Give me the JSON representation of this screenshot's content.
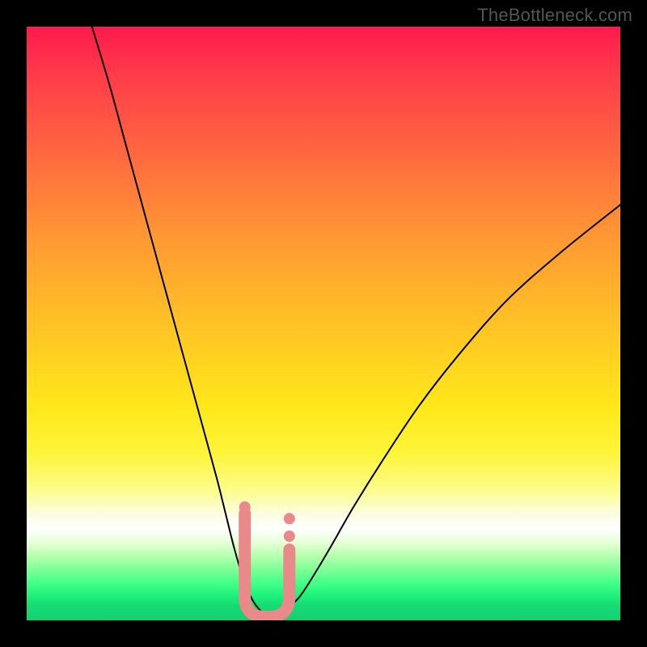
{
  "watermark": "TheBottleneck.com",
  "chart_data": {
    "type": "line",
    "title": "",
    "xlabel": "",
    "ylabel": "",
    "xlim": [
      0,
      100
    ],
    "ylim": [
      0,
      100
    ],
    "grid": false,
    "series": [
      {
        "name": "bottleneck-curve",
        "x": [
          11,
          14,
          17,
          20,
          23,
          26,
          29,
          32,
          33.5,
          35,
          36.5,
          38,
          39.5,
          41,
          42.5,
          44,
          46,
          48,
          51,
          55,
          60,
          66,
          73,
          81,
          90,
          100
        ],
        "y": [
          100,
          90,
          79,
          68,
          57,
          46,
          35,
          24,
          18,
          12,
          7,
          3.5,
          1.5,
          0.5,
          0.8,
          2,
          4,
          7,
          12,
          19,
          27,
          36,
          45,
          54,
          62,
          70
        ]
      }
    ],
    "annotations": [
      {
        "name": "vertex-band",
        "x_center": 40.5,
        "width": 7.5,
        "y_top": 18,
        "shape": "U"
      }
    ],
    "gradient_stops": [
      {
        "pos": 0.0,
        "color": "#ff1a4d"
      },
      {
        "pos": 0.5,
        "color": "#ffc226"
      },
      {
        "pos": 0.82,
        "color": "#fcfce0"
      },
      {
        "pos": 0.845,
        "color": "#ffffff"
      },
      {
        "pos": 1.0,
        "color": "#14d170"
      }
    ]
  }
}
